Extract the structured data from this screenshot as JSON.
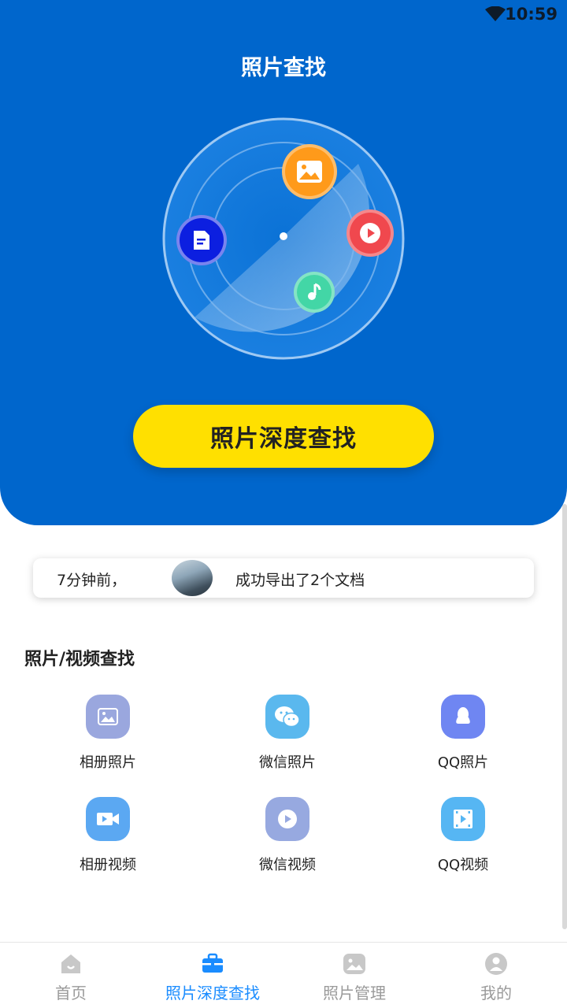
{
  "status_bar": {
    "time": "10:59"
  },
  "header": {
    "title": "照片查找"
  },
  "cta": {
    "label": "照片深度查找"
  },
  "notice": {
    "time_text": "7分钟前，",
    "message": "成功导出了2个文档"
  },
  "section": {
    "title": "照片/视频查找"
  },
  "grid": [
    {
      "label": "相册照片",
      "icon": "album-photo-icon",
      "color": "#9aa7de"
    },
    {
      "label": "微信照片",
      "icon": "wechat-icon",
      "color": "#5ab8ee"
    },
    {
      "label": "QQ照片",
      "icon": "qq-icon",
      "color": "#6f86f2"
    },
    {
      "label": "相册视频",
      "icon": "album-video-icon",
      "color": "#5ba8f2"
    },
    {
      "label": "微信视频",
      "icon": "wechat-video-icon",
      "color": "#97a9e0"
    },
    {
      "label": "QQ视频",
      "icon": "qq-video-icon",
      "color": "#56b6f3"
    }
  ],
  "bottom_nav": [
    {
      "label": "首页",
      "icon": "home-icon",
      "active": false
    },
    {
      "label": "照片深度查找",
      "icon": "briefcase-icon",
      "active": true
    },
    {
      "label": "照片管理",
      "icon": "photo-manage-icon",
      "active": false
    },
    {
      "label": "我的",
      "icon": "profile-icon",
      "active": false
    }
  ],
  "colors": {
    "primary_blue": "#0066cc",
    "cta_yellow": "#ffe000",
    "active_nav": "#1a8cff"
  }
}
